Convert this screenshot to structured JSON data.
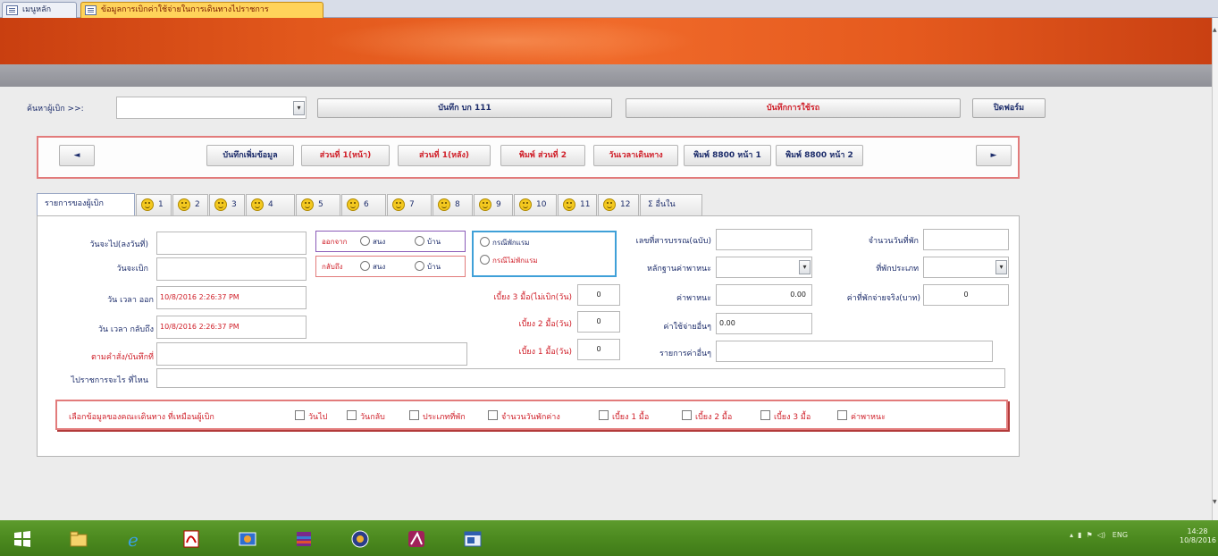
{
  "doc_tabs": [
    "เมนูหลัก",
    "ข้อมูลการเบิกค่าใช้จ่ายในการเดินทางไปราชการ"
  ],
  "search": {
    "label": "ค้นหาผู้เบิก >>:",
    "value": ""
  },
  "top_buttons": {
    "record": "บันทึก บก 111",
    "advance": "บันทึกการใช้รถ",
    "close": "ปิดฟอร์ม"
  },
  "nav": {
    "prev": "◄",
    "next": "►",
    "buttons": [
      "บันทึกเพิ่มข้อมูล",
      "ส่วนที่ 1(หน้า)",
      "ส่วนที่ 1(หลัง)",
      "พิมพ์ ส่วนที่ 2",
      "วันเวลาเดินทาง",
      "พิมพ์ 8800 หน้า 1",
      "พิมพ์ 8800 หน้า 2"
    ]
  },
  "tabs": [
    "รายการของผู้เบิก",
    "1",
    "2",
    "3",
    "4",
    "5",
    "6",
    "7",
    "8",
    "9",
    "10",
    "11",
    "12",
    "Σ อื่นใน"
  ],
  "form": {
    "date_go_label": "วันจะไป(ลงวันที่)",
    "date_go": "",
    "date_back_label": "วันจะเบิก",
    "date_back": "",
    "datetime_out_label": "วัน เวลา ออก",
    "datetime_out": "10/8/2016 2:26:37 PM",
    "datetime_return_label": "วัน เวลา กลับถึง",
    "datetime_return": "10/8/2016 2:26:37 PM",
    "order_label": "ตามคำสั่ง/บันทึกที่",
    "order": "",
    "travel_label": "ไปราชการจะไร ที่ไหน",
    "travel": "",
    "out_group": {
      "label": "ออกจาก",
      "opt1": "สนง",
      "opt2": "บ้าน"
    },
    "back_group": {
      "label": "กลับถึง",
      "opt1": "สนง",
      "opt2": "บ้าน"
    },
    "type_group": {
      "opt1": "กรณีพักแรม",
      "opt2": "กรณีไม่พักแรม"
    },
    "meal3_label": "เบี้ยง 3 มื้อ(ไม่เบิก(วัน)",
    "meal3": "0",
    "meal2_label": "เบี้ยง 2 มื้อ(วัน)",
    "meal2": "0",
    "meal1_label": "เบี้ยง 1 มื้อ(วัน)",
    "meal1": "0",
    "doc_no_label": "เลขที่สารบรรณ(ฉบับ)",
    "doc_no": "",
    "vehicle_label": "หลักฐานค่าพาหนะ",
    "vehicle": "",
    "fare_label": "ค่าพาหนะ",
    "fare": "0.00",
    "other_label": "ค่าใช้จ่ายอื่นๆ",
    "other": "0.00",
    "other_list_label": "รายการค่าอื่นๆ",
    "other_list": "",
    "days_label": "จำนวนวันที่พัก",
    "days": "",
    "lodging_type_label": "ที่พักประเภท",
    "lodging_type": "",
    "lodging_pay_label": "ค่าที่พักจ่ายจริง(บาท)",
    "lodging_pay": "0"
  },
  "checks": {
    "label": "เลือกข้อมูลของคณะเดินทาง ที่เหมือนผู้เบิก",
    "items": [
      "วันไป",
      "วันกลับ",
      "ประเภทที่พัก",
      "จำนวนวันพักค่าง",
      "เบี้ยง 1 มื้อ",
      "เบี้ยง 2 มื้อ",
      "เบี้ยง 3 มื้อ",
      "ค่าพาหนะ"
    ]
  },
  "taskbar": {
    "lang": "ENG",
    "time": "14:28",
    "date": "10/8/2016"
  },
  "colors": {
    "accent_orange": "#e2581c",
    "label_red": "#d0202a",
    "label_navy": "#1d2d6b",
    "taskbar_green": "#4c8a1f"
  }
}
